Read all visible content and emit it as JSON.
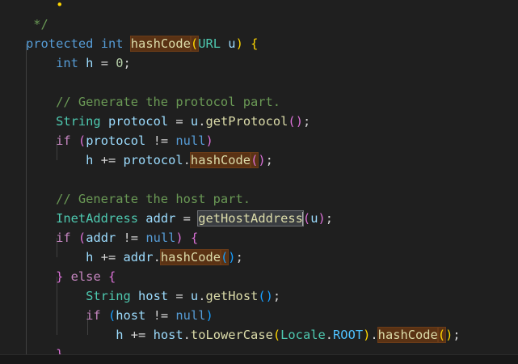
{
  "colors": {
    "background": "#1f1f1f",
    "keyword": "#569cd6",
    "control": "#c586c0",
    "type": "#4ec9b0",
    "function": "#dcdcaa",
    "variable": "#9cdcfe",
    "constant": "#4fc1ff",
    "number": "#b5cea8",
    "comment": "#6a9955",
    "text": "#d4d4d4",
    "bracket1": "#ffd700",
    "bracket2": "#da70d6",
    "bracket3": "#179fff",
    "occurrence_highlight": "#5a3214"
  },
  "code": {
    "lines": [
      {
        "id": "line-0",
        "parts": [
          {
            "t": "    ",
            "c": "text"
          },
          {
            "t": "•",
            "c": "bracket1"
          }
        ]
      },
      {
        "id": "line-1",
        "parts": [
          {
            "t": " */",
            "c": "comment"
          }
        ]
      },
      {
        "id": "line-2",
        "parts": [
          {
            "t": "protected",
            "c": "keyword"
          },
          {
            "t": " ",
            "c": "text"
          },
          {
            "t": "int",
            "c": "keyword"
          },
          {
            "t": " ",
            "c": "text"
          },
          {
            "t": "hashCode",
            "c": "function",
            "hl": true
          },
          {
            "t": "(",
            "c": "bracket1",
            "hl": true
          },
          {
            "t": "URL",
            "c": "type"
          },
          {
            "t": " ",
            "c": "text"
          },
          {
            "t": "u",
            "c": "variable"
          },
          {
            "t": ")",
            "c": "bracket1"
          },
          {
            "t": " ",
            "c": "text"
          },
          {
            "t": "{",
            "c": "bracket1"
          }
        ]
      },
      {
        "id": "line-3",
        "parts": [
          {
            "t": "    ",
            "c": "text"
          },
          {
            "t": "int",
            "c": "keyword"
          },
          {
            "t": " ",
            "c": "text"
          },
          {
            "t": "h",
            "c": "variable"
          },
          {
            "t": " = ",
            "c": "text"
          },
          {
            "t": "0",
            "c": "number"
          },
          {
            "t": ";",
            "c": "text"
          }
        ]
      },
      {
        "id": "line-4",
        "parts": []
      },
      {
        "id": "line-5",
        "parts": [
          {
            "t": "    ",
            "c": "text"
          },
          {
            "t": "// Generate the protocol part.",
            "c": "comment"
          }
        ]
      },
      {
        "id": "line-6",
        "parts": [
          {
            "t": "    ",
            "c": "text"
          },
          {
            "t": "String",
            "c": "type"
          },
          {
            "t": " ",
            "c": "text"
          },
          {
            "t": "protocol",
            "c": "variable"
          },
          {
            "t": " = ",
            "c": "text"
          },
          {
            "t": "u",
            "c": "variable"
          },
          {
            "t": ".",
            "c": "text"
          },
          {
            "t": "getProtocol",
            "c": "function"
          },
          {
            "t": "(",
            "c": "bracket2"
          },
          {
            "t": ")",
            "c": "bracket2"
          },
          {
            "t": ";",
            "c": "text"
          }
        ]
      },
      {
        "id": "line-7",
        "parts": [
          {
            "t": "    ",
            "c": "text"
          },
          {
            "t": "if",
            "c": "control"
          },
          {
            "t": " ",
            "c": "text"
          },
          {
            "t": "(",
            "c": "bracket2"
          },
          {
            "t": "protocol",
            "c": "variable"
          },
          {
            "t": " != ",
            "c": "text"
          },
          {
            "t": "null",
            "c": "keyword"
          },
          {
            "t": ")",
            "c": "bracket2"
          }
        ]
      },
      {
        "id": "line-8",
        "parts": [
          {
            "t": "        ",
            "c": "text"
          },
          {
            "t": "h",
            "c": "variable"
          },
          {
            "t": " += ",
            "c": "text"
          },
          {
            "t": "protocol",
            "c": "variable"
          },
          {
            "t": ".",
            "c": "text"
          },
          {
            "t": "hashCode",
            "c": "function",
            "hl": true
          },
          {
            "t": "(",
            "c": "bracket2",
            "hl": true
          },
          {
            "t": ")",
            "c": "bracket2"
          },
          {
            "t": ";",
            "c": "text"
          }
        ]
      },
      {
        "id": "line-9",
        "parts": []
      },
      {
        "id": "line-10",
        "parts": [
          {
            "t": "    ",
            "c": "text"
          },
          {
            "t": "// Generate the host part.",
            "c": "comment"
          }
        ]
      },
      {
        "id": "line-11",
        "parts": [
          {
            "t": "    ",
            "c": "text"
          },
          {
            "t": "InetAddress",
            "c": "type"
          },
          {
            "t": " ",
            "c": "text"
          },
          {
            "t": "addr",
            "c": "variable"
          },
          {
            "t": " = ",
            "c": "text"
          },
          {
            "t": "getHostAddress",
            "c": "function",
            "sel": true,
            "cursor": true
          },
          {
            "t": "(",
            "c": "bracket2"
          },
          {
            "t": "u",
            "c": "variable"
          },
          {
            "t": ")",
            "c": "bracket2"
          },
          {
            "t": ";",
            "c": "text"
          }
        ]
      },
      {
        "id": "line-12",
        "parts": [
          {
            "t": "    ",
            "c": "text"
          },
          {
            "t": "if",
            "c": "control"
          },
          {
            "t": " ",
            "c": "text"
          },
          {
            "t": "(",
            "c": "bracket2"
          },
          {
            "t": "addr",
            "c": "variable"
          },
          {
            "t": " != ",
            "c": "text"
          },
          {
            "t": "null",
            "c": "keyword"
          },
          {
            "t": ")",
            "c": "bracket2"
          },
          {
            "t": " ",
            "c": "text"
          },
          {
            "t": "{",
            "c": "bracket2"
          }
        ]
      },
      {
        "id": "line-13",
        "parts": [
          {
            "t": "        ",
            "c": "text"
          },
          {
            "t": "h",
            "c": "variable"
          },
          {
            "t": " += ",
            "c": "text"
          },
          {
            "t": "addr",
            "c": "variable"
          },
          {
            "t": ".",
            "c": "text"
          },
          {
            "t": "hashCode",
            "c": "function",
            "hl": true
          },
          {
            "t": "(",
            "c": "bracket3",
            "hl": true
          },
          {
            "t": ")",
            "c": "bracket3"
          },
          {
            "t": ";",
            "c": "text"
          }
        ]
      },
      {
        "id": "line-14",
        "parts": [
          {
            "t": "    ",
            "c": "text"
          },
          {
            "t": "}",
            "c": "bracket2"
          },
          {
            "t": " ",
            "c": "text"
          },
          {
            "t": "else",
            "c": "control"
          },
          {
            "t": " ",
            "c": "text"
          },
          {
            "t": "{",
            "c": "bracket2"
          }
        ]
      },
      {
        "id": "line-15",
        "parts": [
          {
            "t": "        ",
            "c": "text"
          },
          {
            "t": "String",
            "c": "type"
          },
          {
            "t": " ",
            "c": "text"
          },
          {
            "t": "host",
            "c": "variable"
          },
          {
            "t": " = ",
            "c": "text"
          },
          {
            "t": "u",
            "c": "variable"
          },
          {
            "t": ".",
            "c": "text"
          },
          {
            "t": "getHost",
            "c": "function"
          },
          {
            "t": "(",
            "c": "bracket3"
          },
          {
            "t": ")",
            "c": "bracket3"
          },
          {
            "t": ";",
            "c": "text"
          }
        ]
      },
      {
        "id": "line-16",
        "parts": [
          {
            "t": "        ",
            "c": "text"
          },
          {
            "t": "if",
            "c": "control"
          },
          {
            "t": " ",
            "c": "text"
          },
          {
            "t": "(",
            "c": "bracket3"
          },
          {
            "t": "host",
            "c": "variable"
          },
          {
            "t": " != ",
            "c": "text"
          },
          {
            "t": "null",
            "c": "keyword"
          },
          {
            "t": ")",
            "c": "bracket3"
          }
        ]
      },
      {
        "id": "line-17",
        "parts": [
          {
            "t": "            ",
            "c": "text"
          },
          {
            "t": "h",
            "c": "variable"
          },
          {
            "t": " += ",
            "c": "text"
          },
          {
            "t": "host",
            "c": "variable"
          },
          {
            "t": ".",
            "c": "text"
          },
          {
            "t": "toLowerCase",
            "c": "function"
          },
          {
            "t": "(",
            "c": "bracket1"
          },
          {
            "t": "Locale",
            "c": "type"
          },
          {
            "t": ".",
            "c": "text"
          },
          {
            "t": "ROOT",
            "c": "constant"
          },
          {
            "t": ")",
            "c": "bracket1"
          },
          {
            "t": ".",
            "c": "text"
          },
          {
            "t": "hashCode",
            "c": "function",
            "hl": true
          },
          {
            "t": "(",
            "c": "bracket1",
            "hl": true
          },
          {
            "t": ")",
            "c": "bracket1"
          },
          {
            "t": ";",
            "c": "text"
          }
        ]
      },
      {
        "id": "line-18",
        "parts": [
          {
            "t": "    ",
            "c": "text"
          },
          {
            "t": "}",
            "c": "bracket2"
          }
        ]
      }
    ]
  }
}
